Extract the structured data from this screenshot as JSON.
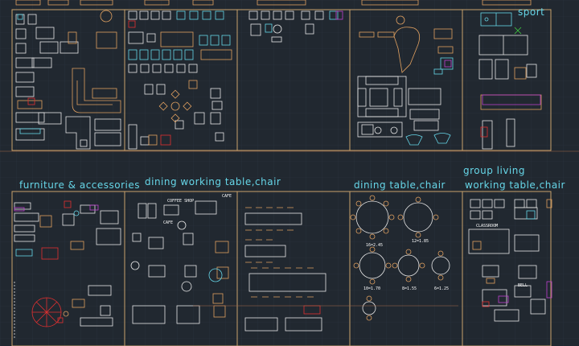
{
  "viewport": {
    "background": "#212830",
    "grid_color": "#2b3440",
    "frame_color": "#c9a26b"
  },
  "colors": {
    "cyan": "#66d6e8",
    "orange": "#e0a060",
    "white": "#e8e8e8",
    "red": "#e23030",
    "magenta": "#c040d0",
    "yellow": "#e8d040",
    "green": "#40d040",
    "brown": "#a66a4a"
  },
  "labels": {
    "sport": "sport",
    "furniture": "furniture & accessories",
    "dining_working": "dining working table,chair",
    "dining_table": "dining table,chair",
    "group_living": "group living",
    "working_table": "working table,chair"
  },
  "small_labels": {
    "cafe_1": "CAFE",
    "coffee_shop": "COFFEE SHOP",
    "cafe_2": "CAFE",
    "classroom": "CLASSROOM",
    "bell": "BELL",
    "t1": "16=2.45",
    "t2": "12=1.85",
    "t3": "10=1.70",
    "t4": "8=1.55",
    "t5": "6=1.25"
  }
}
